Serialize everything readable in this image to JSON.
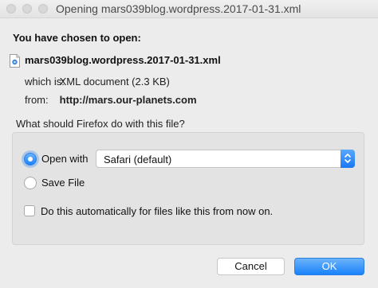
{
  "window": {
    "title": "Opening mars039blog.wordpress.2017-01-31.xml"
  },
  "dialog": {
    "heading": "You have chosen to open:",
    "file_name": "mars039blog.wordpress.2017-01-31.xml",
    "which_label": "which is:",
    "which_value": "XML document (2.3 KB)",
    "from_label": "from:",
    "from_value": "http://mars.our-planets.com",
    "question": "What should Firefox do with this file?",
    "options": {
      "open_with_label": "Open with",
      "open_with_selected": true,
      "app_selected": "Safari (default)",
      "save_file_label": "Save File",
      "save_file_selected": false,
      "auto_label": "Do this automatically for files like this from now on.",
      "auto_checked": false
    },
    "buttons": {
      "cancel": "Cancel",
      "ok": "OK"
    }
  },
  "colors": {
    "accent": "#1a82fb",
    "window_bg": "#ececec",
    "group_bg": "#e3e3e3"
  },
  "icons": {
    "file": "document-icon",
    "stepper": "chevron-updown-icon"
  }
}
